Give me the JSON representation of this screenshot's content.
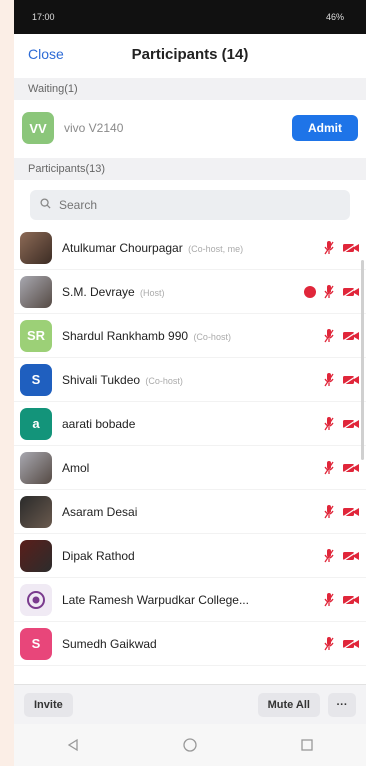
{
  "statusbar": {
    "left": "17:00",
    "right": "46%"
  },
  "header": {
    "close_label": "Close",
    "title": "Participants (14)"
  },
  "waiting": {
    "section_label": "Waiting(1)",
    "avatar_initials": "VV",
    "name": "vivo V2140",
    "admit_label": "Admit",
    "avatar_color": "#8bc67a"
  },
  "participants_label": "Participants(13)",
  "search": {
    "placeholder": "Search"
  },
  "participants": [
    {
      "name": "Atulkumar Chourpagar",
      "tag": "(Co-host, me)",
      "avatar": "photo",
      "initials": ""
    },
    {
      "name": "S.M. Devraye",
      "tag": "(Host)",
      "avatar": "photo2",
      "initials": "",
      "recording": true
    },
    {
      "name": "Shardul Rankhamb 990",
      "tag": "(Co-host)",
      "avatar": "color",
      "initials": "SR",
      "color": "#9cd077"
    },
    {
      "name": "Shivali Tukdeo",
      "tag": "(Co-host)",
      "avatar": "color",
      "initials": "S",
      "color": "#1f5fbf"
    },
    {
      "name": "aarati bobade",
      "tag": "",
      "avatar": "color",
      "initials": "a",
      "color": "#13947a"
    },
    {
      "name": "Amol",
      "tag": "",
      "avatar": "photo2",
      "initials": ""
    },
    {
      "name": "Asaram Desai",
      "tag": "",
      "avatar": "photo3",
      "initials": ""
    },
    {
      "name": "Dipak Rathod",
      "tag": "",
      "avatar": "photo4",
      "initials": ""
    },
    {
      "name": "Late Ramesh Warpudkar College...",
      "tag": "",
      "avatar": "logo",
      "initials": ""
    },
    {
      "name": "Sumedh Gaikwad",
      "tag": "",
      "avatar": "color",
      "initials": "S",
      "color": "#e8467a"
    }
  ],
  "bottom": {
    "invite_label": "Invite",
    "mute_all_label": "Mute All",
    "more_label": "···"
  },
  "colors": {
    "accent": "#1e74e8",
    "muted_icon": "#e0263a"
  }
}
